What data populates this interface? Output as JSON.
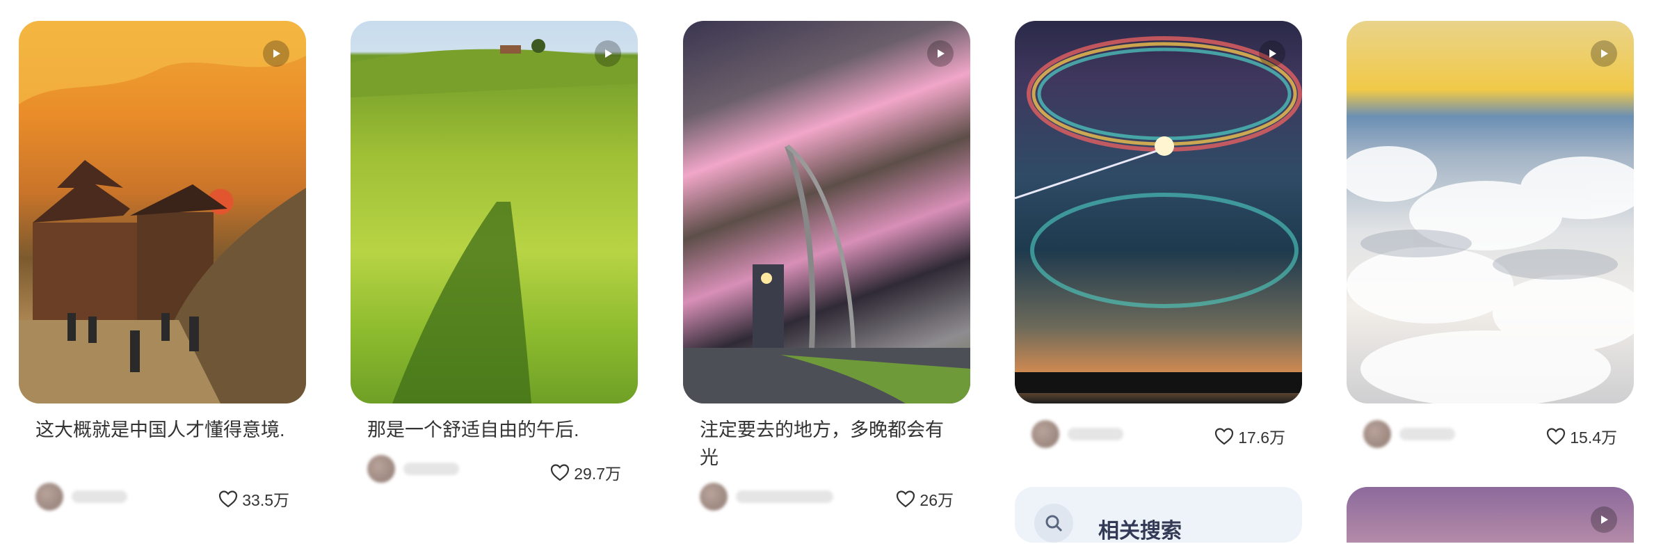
{
  "cards": [
    {
      "title": "这大概就是中国人才懂得意境.",
      "likes": "33.5万"
    },
    {
      "title": "那是一个舒适自由的午后.",
      "likes": "29.7万"
    },
    {
      "title": "注定要去的地方，多晚都会有光",
      "likes": "26万"
    },
    {
      "title": "",
      "likes": "17.6万"
    },
    {
      "title": "",
      "likes": "15.4万"
    }
  ],
  "related_search": {
    "label": "相关搜索",
    "icon": "search-icon"
  },
  "icons": {
    "play": "play-icon",
    "like": "heart-icon"
  }
}
